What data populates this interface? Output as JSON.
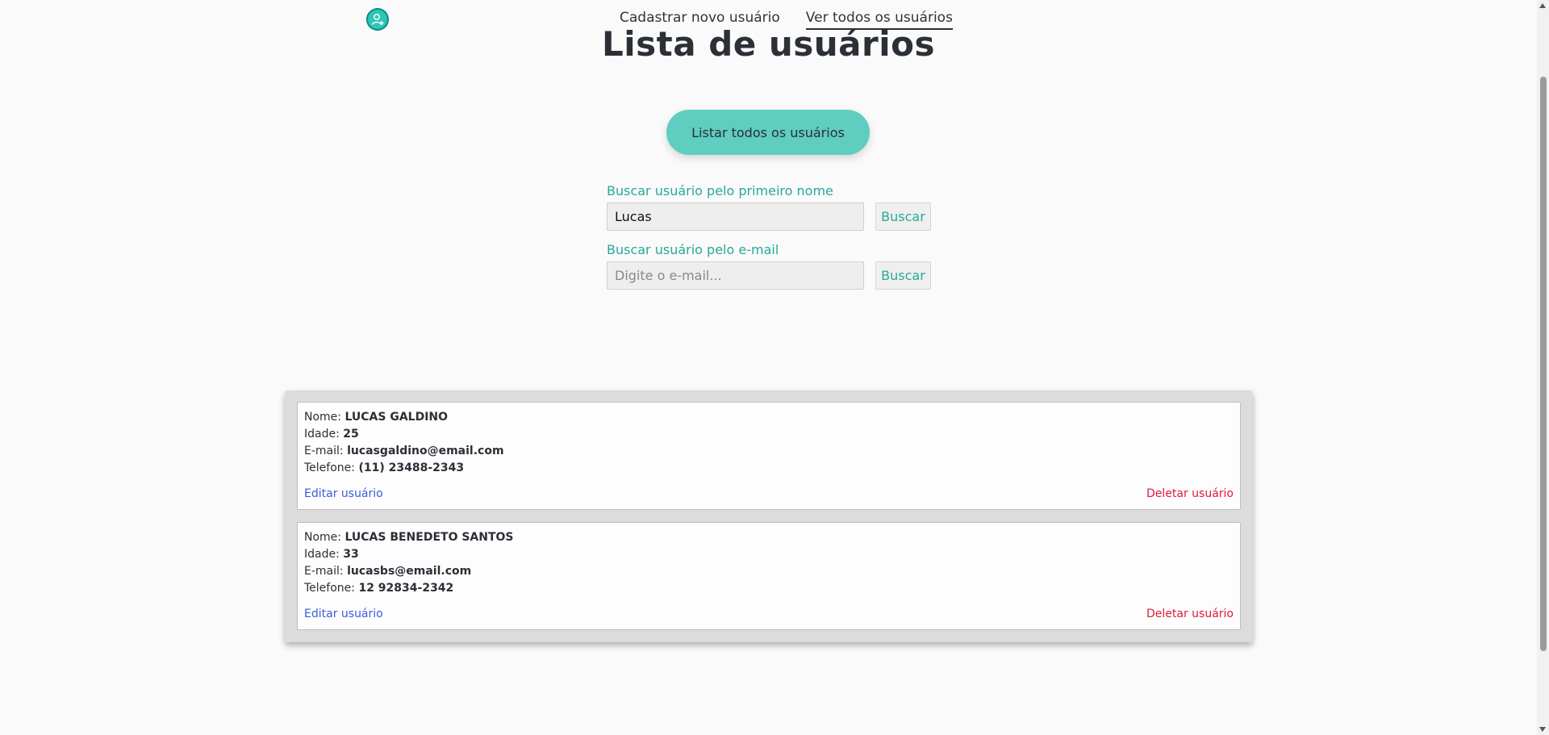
{
  "nav": {
    "logo_icon": "user-plus-icon",
    "items": [
      {
        "label": "Cadastrar novo usuário",
        "active": false
      },
      {
        "label": "Ver todos os usuários",
        "active": true
      }
    ]
  },
  "page": {
    "title": "Lista de usuários"
  },
  "list_all_label": "Listar todos os usuários",
  "search_by_name": {
    "label": "Buscar usuário pelo primeiro nome",
    "value": "Lucas",
    "button_label": "Buscar"
  },
  "search_by_email": {
    "label": "Buscar usuário pelo e-mail",
    "placeholder": "Digite o e-mail...",
    "value": "",
    "button_label": "Buscar"
  },
  "field_labels": {
    "name": "Nome:",
    "age": "Idade:",
    "email": "E-mail:",
    "phone": "Telefone:"
  },
  "users": [
    {
      "name": "LUCAS GALDINO",
      "age": "25",
      "email": "lucasgaldino@email.com",
      "phone": "(11) 23488-2343",
      "edit_label": "Editar usuário",
      "delete_label": "Deletar usuário"
    },
    {
      "name": "LUCAS BENEDETO SANTOS",
      "age": "33",
      "email": "lucasbs@email.com",
      "phone": "12 92834-2342",
      "edit_label": "Editar usuário",
      "delete_label": "Deletar usuário"
    }
  ],
  "colors": {
    "accent": "#27a99a",
    "button_bg": "#5fcdbf",
    "edit_link": "#3b5ed6",
    "delete_link": "#e0193a"
  }
}
